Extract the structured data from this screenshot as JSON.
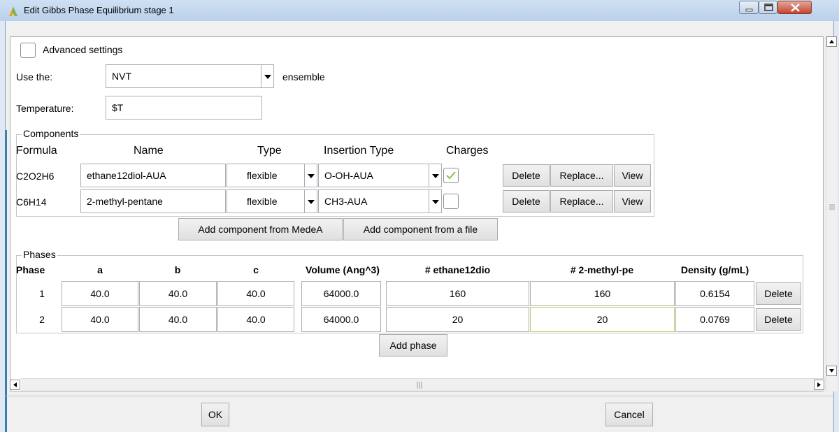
{
  "window": {
    "title": "Edit Gibbs Phase Equilibrium stage 1"
  },
  "advanced": {
    "label": "Advanced settings",
    "checked": false
  },
  "ensemble": {
    "prefix": "Use the:",
    "value": "NVT",
    "suffix": "ensemble"
  },
  "temperature": {
    "label": "Temperature:",
    "value": "$T"
  },
  "components": {
    "title": "Components",
    "headers": {
      "formula": "Formula",
      "name": "Name",
      "type": "Type",
      "insertion": "Insertion Type",
      "charges": "Charges"
    },
    "rows": [
      {
        "formula": "C2O2H6",
        "name": "ethane12diol-AUA",
        "type": "flexible",
        "insertion": "O-OH-AUA",
        "charges": true,
        "delete": "Delete",
        "replace": "Replace...",
        "view": "View"
      },
      {
        "formula": "C6H14",
        "name": "2-methyl-pentane",
        "type": "flexible",
        "insertion": "CH3-AUA",
        "charges": false,
        "delete": "Delete",
        "replace": "Replace...",
        "view": "View"
      }
    ],
    "add_medea": "Add component from MedeA",
    "add_file": "Add component from a file"
  },
  "phases": {
    "title": "Phases",
    "headers": {
      "phase": "Phase",
      "a": "a",
      "b": "b",
      "c": "c",
      "volume": "Volume (Ang^3)",
      "n1": "# ethane12dio",
      "n2": "# 2-methyl-pe",
      "density": "Density (g/mL)"
    },
    "rows": [
      {
        "phase": "1",
        "a": "40.0",
        "b": "40.0",
        "c": "40.0",
        "volume": "64000.0",
        "n1": "160",
        "n2": "160",
        "density": "0.6154",
        "delete": "Delete"
      },
      {
        "phase": "2",
        "a": "40.0",
        "b": "40.0",
        "c": "40.0",
        "volume": "64000.0",
        "n1": "20",
        "n2": "20",
        "density": "0.0769",
        "delete": "Delete"
      }
    ],
    "add_phase": "Add phase"
  },
  "footer": {
    "ok": "OK",
    "cancel": "Cancel"
  },
  "colors": {
    "check_green": "#7bbf3a",
    "focus_border": "#b7d45e",
    "title_bar": "#c4d8ef"
  }
}
